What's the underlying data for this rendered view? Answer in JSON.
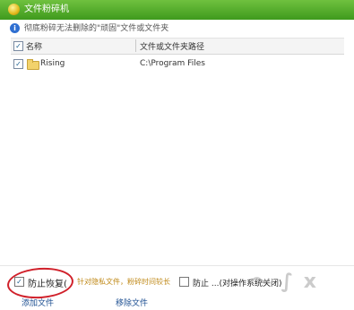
{
  "window": {
    "title": "文件粉碎机"
  },
  "info": {
    "message": "彻底粉碎无法删除的\"顽固\"文件或文件夹"
  },
  "table": {
    "headers": [
      "名称",
      "文件或文件夹路径"
    ],
    "rows": [
      {
        "checked": true,
        "name": "Rising",
        "path": "C:\\Program Files"
      }
    ]
  },
  "options": {
    "prevent_recovery": {
      "checked": true,
      "label": "防止恢复(",
      "hint": "针对隐私文件，粉碎时间较长"
    },
    "option2": {
      "checked": false,
      "label": "防止 ...(对操作系统关闭)"
    }
  },
  "actions": {
    "add": "添加文件",
    "remove": "移除文件"
  },
  "colors": {
    "titlebar": "#4faf27",
    "link": "#1d4f91",
    "highlight_ring": "#d0202a"
  }
}
